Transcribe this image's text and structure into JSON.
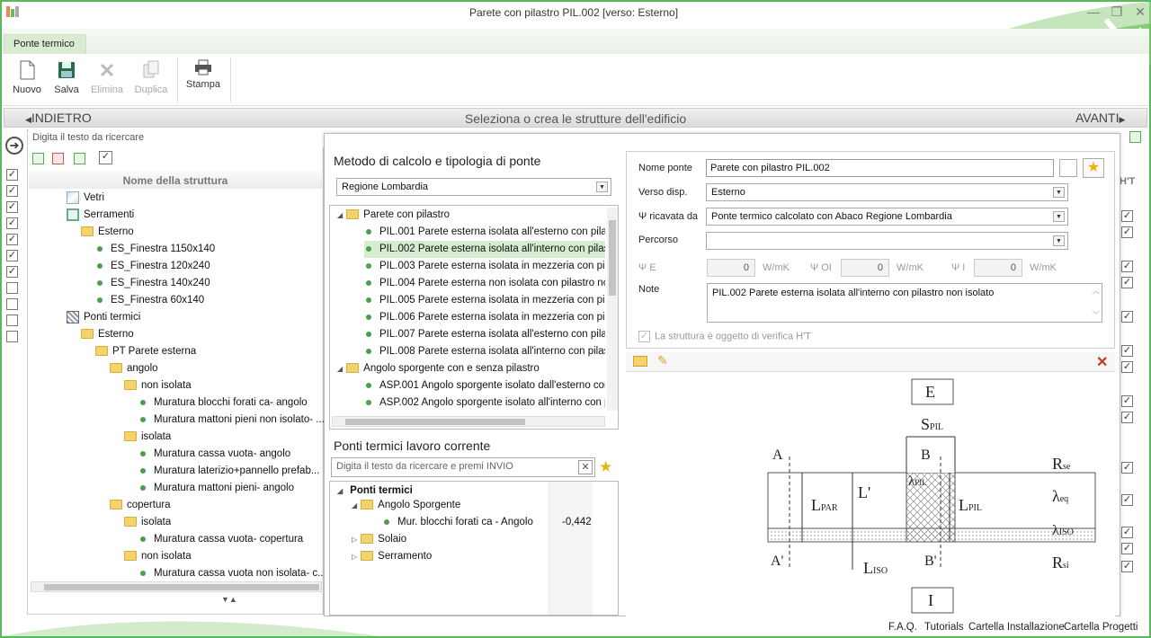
{
  "window": {
    "title": "Parete con pilastro PIL.002 [verso: Esterno]"
  },
  "ribbon": {
    "tab": "Ponte termico",
    "buttons": [
      {
        "label": "Nuovo"
      },
      {
        "label": "Salva"
      },
      {
        "label": "Elimina"
      },
      {
        "label": "Duplica"
      },
      {
        "label": "Stampa"
      }
    ]
  },
  "nav": {
    "back": "INDIETRO",
    "center": "Seleziona o crea le strutture dell'edificio",
    "next": "AVANTI"
  },
  "left": {
    "search_placeholder": "Digita il testo da ricercare",
    "header": "Nome della struttura",
    "tree": [
      {
        "label": "Vetri"
      },
      {
        "label": "Serramenti"
      },
      {
        "label": "Esterno"
      },
      {
        "label": "ES_Finestra 1150x140"
      },
      {
        "label": "ES_Finestra 120x240"
      },
      {
        "label": "ES_Finestra 140x240"
      },
      {
        "label": "ES_Finestra 60x140"
      },
      {
        "label": "Ponti termici"
      },
      {
        "label": "Esterno"
      },
      {
        "label": "PT Parete esterna"
      },
      {
        "label": "angolo"
      },
      {
        "label": "non isolata"
      },
      {
        "label": "Muratura blocchi forati ca- angolo"
      },
      {
        "label": "Muratura mattoni pieni non isolato- ..."
      },
      {
        "label": "isolata"
      },
      {
        "label": "Muratura cassa vuota- angolo"
      },
      {
        "label": "Muratura laterizio+pannello prefab..."
      },
      {
        "label": "Muratura mattoni pieni- angolo"
      },
      {
        "label": "copertura"
      },
      {
        "label": "isolata"
      },
      {
        "label": "Muratura cassa vuota- copertura"
      },
      {
        "label": "non isolata"
      },
      {
        "label": "Muratura cassa vuota non isolata- c..."
      }
    ]
  },
  "method": {
    "title": "Metodo di calcolo e tipologia di ponte",
    "select": "Regione Lombardia",
    "tree": [
      {
        "label": "Parete con pilastro"
      },
      {
        "label": "PIL.001 Parete esterna isolata all'esterno con pilas"
      },
      {
        "label": "PIL.002 Parete esterna isolata all'interno con pilast"
      },
      {
        "label": "PIL.003 Parete esterna isolata in mezzeria con pila:"
      },
      {
        "label": "PIL.004 Parete esterna non isolata con pilastro nor"
      },
      {
        "label": "PIL.005 Parete esterna isolata in mezzeria con pila:"
      },
      {
        "label": "PIL.006 Parete esterna isolata in mezzeria con pila:"
      },
      {
        "label": "PIL.007 Parete esterna isolata all'esterno con pilas"
      },
      {
        "label": "PIL.008 Parete esterna isolata all'interno con pilast"
      },
      {
        "label": "Angolo sporgente con e senza pilastro"
      },
      {
        "label": "ASP.001 Angolo sporgente isolato dall'esterno con"
      },
      {
        "label": "ASP.002 Angolo sporgente isolato all'interno con pi"
      }
    ]
  },
  "current": {
    "title": "Ponti termici lavoro corrente",
    "search_placeholder": "Digita il testo da ricercare e premi INVIO",
    "tree": [
      {
        "label": "Ponti termici"
      },
      {
        "label": "Angolo Sporgente"
      },
      {
        "label": "Mur. blocchi forati ca - Angolo",
        "value": "-0,442"
      },
      {
        "label": "Solaio"
      },
      {
        "label": "Serramento"
      }
    ]
  },
  "form": {
    "nome_ponte_label": "Nome ponte",
    "nome_ponte": "Parete con pilastro PIL.002",
    "verso_label": "Verso disp.",
    "verso": "Esterno",
    "psi_label": "Ψ ricavata da",
    "psi": "Ponte termico calcolato con Abaco Regione Lombardia",
    "percorso_label": "Percorso",
    "percorso": "",
    "psiE_label": "Ψ E",
    "psiE": "0",
    "psiOI_label": "Ψ OI",
    "psiOI": "0",
    "psiI_label": "Ψ I",
    "psiI": "0",
    "unit": "W/mK",
    "note_label": "Note",
    "note": "PIL.002 Parete esterna isolata all'interno con pilastro non isolato",
    "verifica_label": "La struttura è oggetto di verifica H'T"
  },
  "diagram": {
    "E": "E",
    "I": "I",
    "A": "A",
    "A2": "A'",
    "B": "B",
    "B2": "B'",
    "SPIL": "S",
    "SPIL_sub": "PIL",
    "LPAR": "L",
    "LPAR_sub": "PAR",
    "L1": "L'",
    "LPIL": "L",
    "LPIL_sub": "PIL",
    "LISO": "L",
    "LISO_sub": "ISO",
    "lPIL": "λ",
    "lPIL_sub": "PIL",
    "Rse": "R",
    "Rse_sub": "se",
    "leq": "λ",
    "leq_sub": "eq",
    "lISO": "λ",
    "lISO_sub": "ISO",
    "Rsi": "R",
    "Rsi_sub": "si"
  },
  "rightcol": {
    "header": "H'T"
  },
  "footer": [
    "F.A.Q.",
    "Tutorials",
    "Cartella Installazione",
    "Cartella Progetti"
  ],
  "colors": {
    "accent": "#5bb85b",
    "selected": "#d5ecd0",
    "folder": "#f3d36b"
  }
}
